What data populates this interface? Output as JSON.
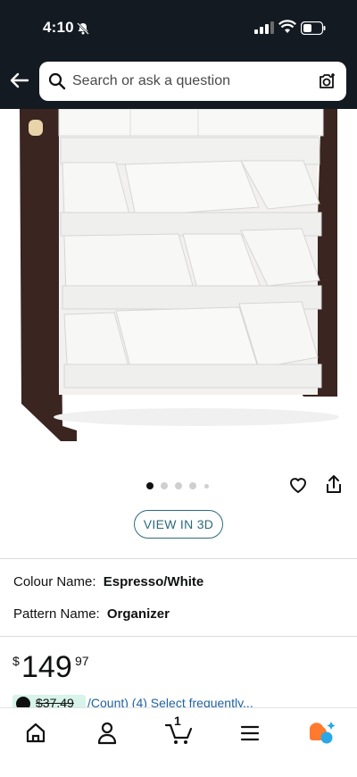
{
  "status_bar": {
    "time": "4:10"
  },
  "search": {
    "placeholder": "Search or ask a question"
  },
  "product": {
    "image_count": 5,
    "active_image": 1,
    "view_3d_label": "VIEW IN 3D"
  },
  "attributes": [
    {
      "label": "Colour Name:",
      "value": "Espresso/White"
    },
    {
      "label": "Pattern Name:",
      "value": "Organizer"
    }
  ],
  "price": {
    "currency": "$",
    "whole": "149",
    "fraction": "97"
  },
  "deal": {
    "was": "$37.49",
    "more": "/Count) (4) Select frequently..."
  },
  "bottom_nav": {
    "cart_count": "1",
    "items": [
      "home-icon",
      "account-icon",
      "cart-icon",
      "menu-icon",
      "rufus-icon"
    ]
  },
  "colors": {
    "header_bg": "#131a22",
    "link": "#2162a1",
    "view3d": "#2b6b7a",
    "deal_bg": "#d7f3ea"
  }
}
